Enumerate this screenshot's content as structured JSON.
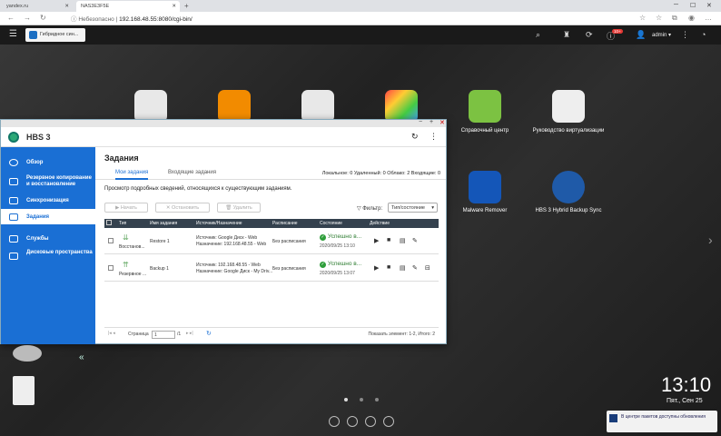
{
  "browser": {
    "tabs": [
      {
        "label": "yandex.ru"
      },
      {
        "label": "NAS3E3F5E"
      }
    ],
    "new_tab": "+",
    "address": {
      "secure_label": "Небезопасно",
      "url": "192.168.48.55:8080/cgi-bin/"
    }
  },
  "topbar": {
    "app_tab": "Гибридное син...",
    "notif_badge": "10+",
    "user": "admin ▾"
  },
  "desktop": {
    "icons": [
      {
        "label": ""
      },
      {
        "label": ""
      },
      {
        "label": ""
      },
      {
        "label": ""
      },
      {
        "label": "Справочный центр"
      },
      {
        "label": "Руководство виртуализации"
      },
      {
        "label": "Malware Remover"
      },
      {
        "label": "HBS 3 Hybrid Backup Sync"
      }
    ],
    "clock": "13:10",
    "date": "Пят., Сен 25",
    "notification": "В центре пакетов доступны обновления"
  },
  "window": {
    "title": "HBS 3",
    "sidebar": [
      {
        "label": "Обзор"
      },
      {
        "label": "Резервное копирование и восстановление"
      },
      {
        "label": "Синхронизация"
      },
      {
        "label": "Задания"
      },
      {
        "label": "Службы"
      },
      {
        "label": "Дисковые пространства"
      }
    ],
    "collapse": "«",
    "page_title": "Задания",
    "subtabs": [
      {
        "label": "Мои задания"
      },
      {
        "label": "Входящие задания"
      }
    ],
    "counts": "Локальное: 0  Удаленный: 0  Облако: 2  Входящие: 0",
    "description": "Просмотр подробных сведений, относящихся к существующим заданиям.",
    "buttons": {
      "start": "▶ Начать",
      "stop": "✕ Остановить",
      "delete": "🗑 Удалить"
    },
    "filter_label": "Фильтр:",
    "filter_value": "Тип/состояние",
    "columns": [
      "Тип",
      "Имя задания",
      "Источник/Назначение",
      "Расписание",
      "Состояние",
      "Действие"
    ],
    "rows": [
      {
        "type": "Восстанов...",
        "name": "Restore 1",
        "source": "Источник: Google Диск - Web",
        "dest": "Назначение: 192.168.48.55 - Web",
        "schedule": "Без расписания",
        "status": "Успешно в...",
        "date": "2020/09/25 13:10"
      },
      {
        "type": "Резервное ...",
        "name": "Backup 1",
        "source": "Источник: 192.168.48.55 - Web",
        "dest": "Назначение: Google Диск - My Driv...",
        "schedule": "Без расписания",
        "status": "Успешно в...",
        "date": "2020/09/25 13:07"
      }
    ],
    "pager": {
      "page_label": "Страница",
      "page_value": "1",
      "of": "/1",
      "summary": "Показать элемент: 1-2, Итого: 2"
    }
  }
}
